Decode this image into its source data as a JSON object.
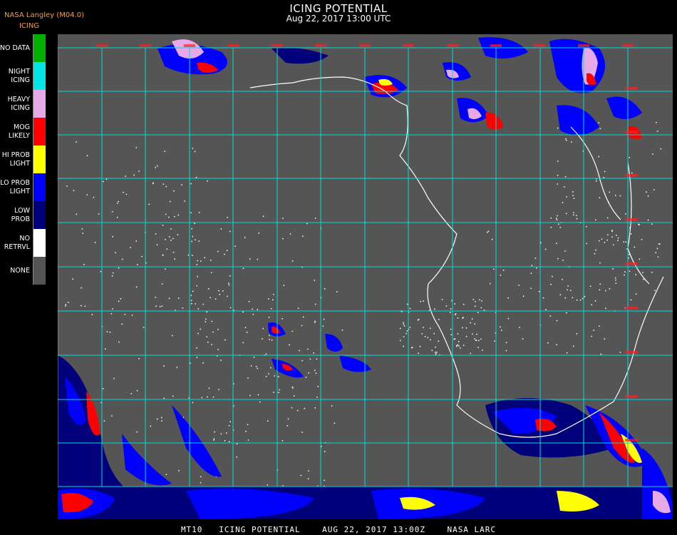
{
  "header": {
    "source": "NASA Langley (M04.0)",
    "product": "ICING",
    "title": "ICING POTENTIAL",
    "subtitle": "Aug 22, 2017 13:00 UTC"
  },
  "legend": {
    "items": [
      {
        "label": "NO DATA",
        "color": "#00b000"
      },
      {
        "label": "NIGHT\nICING",
        "color": "#00e5e5"
      },
      {
        "label": "HEAVY\nICING",
        "color": "#e6a8e6"
      },
      {
        "label": "MOG\nLIKELY",
        "color": "#ff0000"
      },
      {
        "label": "HI PROB\nLIGHT",
        "color": "#ffff00"
      },
      {
        "label": "LO PROB\nLIGHT",
        "color": "#0000ff"
      },
      {
        "label": "LOW\nPROB",
        "color": "#00007a"
      },
      {
        "label": "NO\nRETRVL",
        "color": "#ffffff"
      },
      {
        "label": "NONE",
        "color": "#555555"
      }
    ]
  },
  "map": {
    "background_color": "#555555",
    "grid_color": "#00dddd",
    "coastline_color": "#ffffff",
    "label_color": "#ff2020"
  },
  "footer": {
    "text": "MT10   ICING POTENTIAL    AUG 22, 2017 13:00Z    NASA LARC"
  }
}
